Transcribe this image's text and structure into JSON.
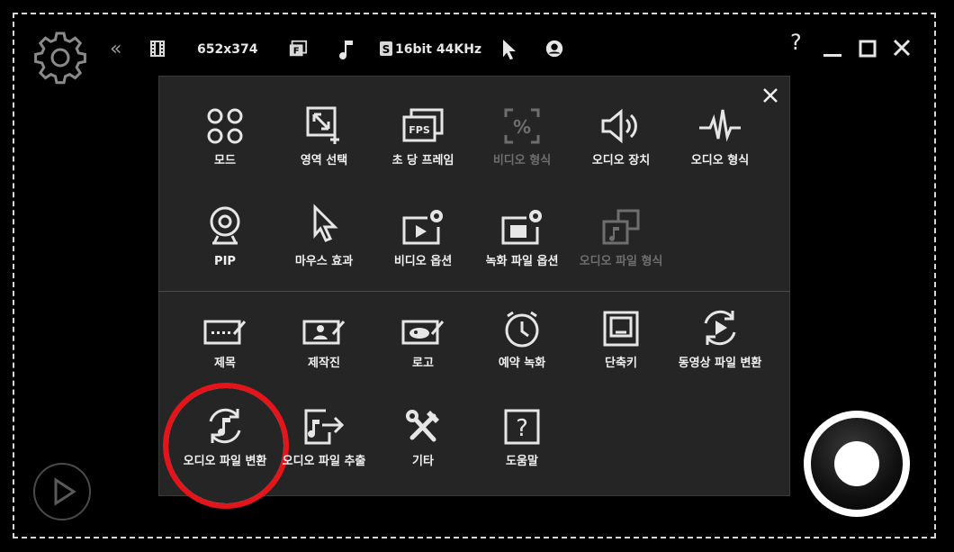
{
  "toolbar": {
    "resolution": "652x374",
    "audio_format": "16bit 44KHz",
    "help_label": "?"
  },
  "menu": {
    "row1": [
      {
        "label": "모드",
        "icon": "mode-icon",
        "enabled": true
      },
      {
        "label": "영역 선택",
        "icon": "area-select-icon",
        "enabled": true
      },
      {
        "label": "초 당 프레임",
        "icon": "fps-icon",
        "enabled": true
      },
      {
        "label": "비디오 형식",
        "icon": "video-format-icon",
        "enabled": false
      },
      {
        "label": "오디오 장치",
        "icon": "speaker-icon",
        "enabled": true
      },
      {
        "label": "오디오 형식",
        "icon": "waveform-icon",
        "enabled": true
      }
    ],
    "row2": [
      {
        "label": "PIP",
        "icon": "webcam-icon",
        "enabled": true
      },
      {
        "label": "마우스 효과",
        "icon": "cursor-icon",
        "enabled": true
      },
      {
        "label": "비디오 옵션",
        "icon": "video-options-icon",
        "enabled": true
      },
      {
        "label": "녹화 파일 옵션",
        "icon": "record-file-options-icon",
        "enabled": true
      },
      {
        "label": "오디오 파일 형식",
        "icon": "audio-file-format-icon",
        "enabled": false
      }
    ],
    "row3": [
      {
        "label": "제목",
        "icon": "title-icon",
        "enabled": true
      },
      {
        "label": "제작진",
        "icon": "credits-icon",
        "enabled": true
      },
      {
        "label": "로고",
        "icon": "logo-icon",
        "enabled": true
      },
      {
        "label": "예약 녹화",
        "icon": "clock-icon",
        "enabled": true
      },
      {
        "label": "단축키",
        "icon": "hotkey-icon",
        "enabled": true
      },
      {
        "label": "동영상 파일 변환",
        "icon": "video-convert-icon",
        "enabled": true
      }
    ],
    "row4": [
      {
        "label": "오디오 파일 변환",
        "icon": "audio-convert-icon",
        "enabled": true
      },
      {
        "label": "오디오 파일 추출",
        "icon": "audio-extract-icon",
        "enabled": true
      },
      {
        "label": "기타",
        "icon": "tools-icon",
        "enabled": true
      },
      {
        "label": "도움말",
        "icon": "help-icon",
        "enabled": true
      }
    ]
  },
  "colors": {
    "background": "#000000",
    "panel": "#252525",
    "text": "#f0f0f0",
    "disabled_text": "#6e6e6e",
    "highlight": "#e3141a"
  }
}
